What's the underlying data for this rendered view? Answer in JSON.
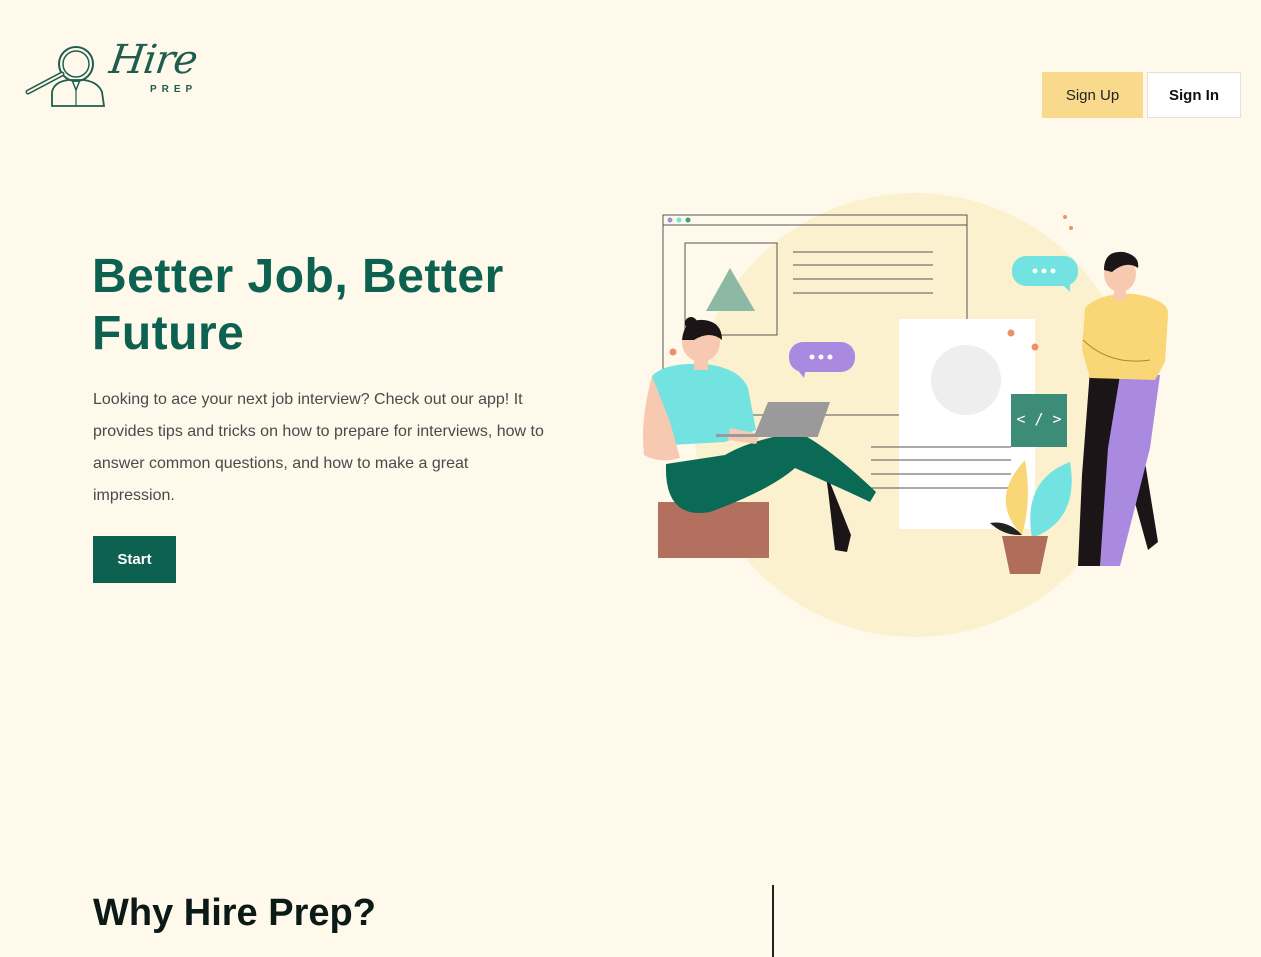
{
  "brand": {
    "name_script": "Hire",
    "name_sub": "PREP"
  },
  "nav": {
    "signup_label": "Sign Up",
    "signin_label": "Sign In"
  },
  "hero": {
    "title": "Better Job, Better Future",
    "description": "Looking to ace your next job interview? Check out our app! It provides tips and tricks on how to prepare for interviews, how to answer common questions, and how to make a great impression.",
    "cta_label": "Start",
    "code_badge": "< / >"
  },
  "section": {
    "why_title": "Why Hire Prep?"
  },
  "colors": {
    "background": "#fef9ea",
    "primary": "#0d6150",
    "signup_bg": "#f9d98b",
    "illus_circle": "#fbf1cf",
    "cyan": "#72e3e0",
    "purple": "#a98ae0",
    "yellow": "#f9d676"
  }
}
